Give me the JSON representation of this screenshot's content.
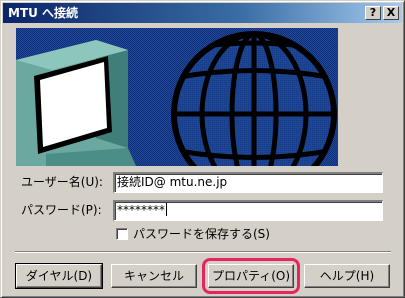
{
  "window": {
    "title": "MTU へ接続",
    "help_button": "?",
    "close_button": "X"
  },
  "form": {
    "username_label": "ユーザー名(U):",
    "username_value": "接続ID@ mtu.ne.jp",
    "password_label": "パスワード(P):",
    "password_value": "********",
    "save_password_label": "パスワードを保存する(S)",
    "save_password_checked": false
  },
  "buttons": {
    "dial": "ダイヤル(D)",
    "cancel": "キャンセル",
    "properties": "プロパティ(O)",
    "help": "ヘルプ(H)"
  },
  "colors": {
    "highlight_ring": "#e8245f",
    "banner_blue": "#1a3f8a",
    "title_bar": "#0a246a"
  },
  "icons": {
    "banner": "computer-and-globe-illustration"
  }
}
